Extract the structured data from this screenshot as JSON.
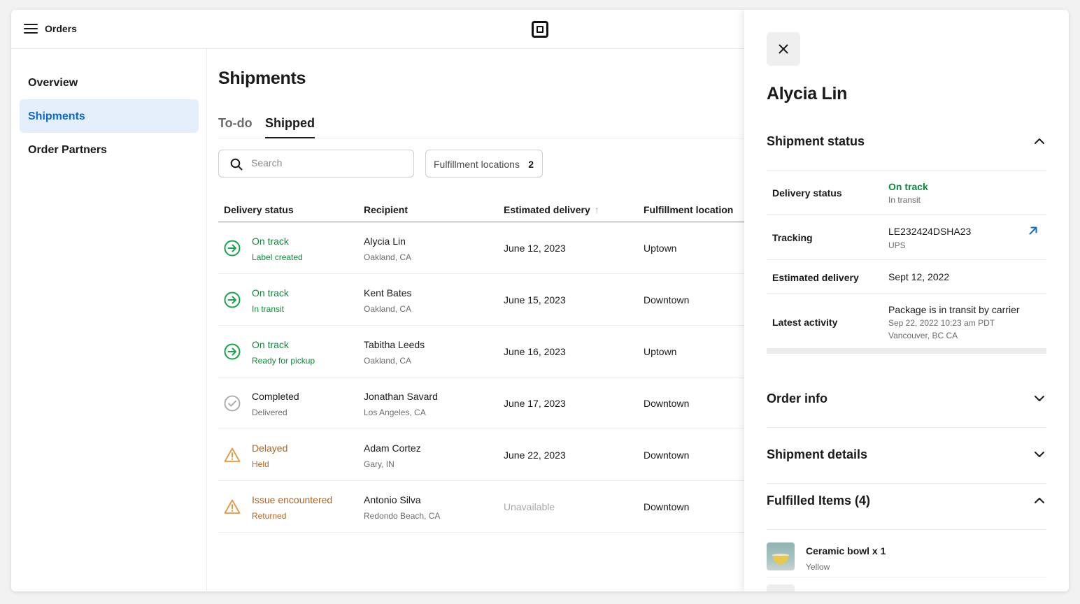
{
  "app": {
    "title": "Orders"
  },
  "sidebar": {
    "items": [
      {
        "label": "Overview",
        "active": false
      },
      {
        "label": "Shipments",
        "active": true
      },
      {
        "label": "Order Partners",
        "active": false
      }
    ]
  },
  "main": {
    "title": "Shipments",
    "tabs": [
      {
        "label": "To-do",
        "active": false
      },
      {
        "label": "Shipped",
        "active": true
      }
    ],
    "search": {
      "placeholder": "Search",
      "value": ""
    },
    "filter": {
      "label": "Fulfillment locations",
      "count": "2"
    },
    "table": {
      "headers": {
        "status": "Delivery status",
        "recipient": "Recipient",
        "delivery": "Estimated delivery",
        "location": "Fulfillment location"
      },
      "sort": {
        "column": "Estimated delivery",
        "direction": "ascending"
      },
      "rows": [
        {
          "status": "On track",
          "sub": "Label created",
          "status_kind": "on-track",
          "recipient": "Alycia Lin",
          "city": "Oakland, CA",
          "date": "June 12, 2023",
          "location": "Uptown"
        },
        {
          "status": "On track",
          "sub": "In transit",
          "status_kind": "on-track",
          "recipient": "Kent Bates",
          "city": "Oakland, CA",
          "date": "June 15, 2023",
          "location": "Downtown"
        },
        {
          "status": "On track",
          "sub": "Ready for pickup",
          "status_kind": "on-track",
          "recipient": "Tabitha Leeds",
          "city": "Oakland, CA",
          "date": "June 16, 2023",
          "location": "Uptown"
        },
        {
          "status": "Completed",
          "sub": "Delivered",
          "status_kind": "completed",
          "recipient": "Jonathan Savard",
          "city": "Los Angeles, CA",
          "date": "June 17, 2023",
          "location": "Downtown"
        },
        {
          "status": "Delayed",
          "sub": "Held",
          "status_kind": "warning",
          "recipient": "Adam Cortez",
          "city": "Gary, IN",
          "date": "June 22, 2023",
          "location": "Downtown"
        },
        {
          "status": "Issue encountered",
          "sub": "Returned",
          "status_kind": "warning",
          "recipient": "Antonio Silva",
          "city": "Redondo Beach, CA",
          "date": "Unavailable",
          "location": "Downtown"
        }
      ]
    }
  },
  "panel": {
    "title": "Alycia Lin",
    "shipment_status": {
      "title": "Shipment status",
      "expanded": true,
      "delivery_status": {
        "label": "Delivery status",
        "value": "On track",
        "sub": "In transit"
      },
      "tracking": {
        "label": "Tracking",
        "value": "LE232424DSHA23",
        "sub": "UPS"
      },
      "estimated_delivery": {
        "label": "Estimated delivery",
        "value": "Sept 12, 2022"
      },
      "latest_activity": {
        "label": "Latest activity",
        "value": "Package is in transit by carrier",
        "time": "Sep 22, 2022 10:23 am PDT",
        "place": "Vancouver, BC CA"
      }
    },
    "order_info": {
      "title": "Order info",
      "expanded": false
    },
    "shipment_details": {
      "title": "Shipment details",
      "expanded": false
    },
    "fulfilled_items": {
      "title": "Fulfilled Items (4)",
      "expanded": true,
      "items": [
        {
          "name": "Ceramic bowl x 1",
          "variant": "Yellow"
        }
      ]
    }
  },
  "icons": {
    "menu": "menu-icon",
    "logo": "square-logo-icon",
    "search": "search-icon",
    "on_track": "arrow-circle-right-icon",
    "completed": "check-circle-icon",
    "warning": "warning-triangle-icon",
    "close": "close-icon",
    "external": "external-link-icon",
    "chevron_up": "chevron-up-icon",
    "chevron_down": "chevron-down-icon"
  },
  "colors": {
    "accent": "#0b6bd4",
    "accent_bg": "#e5effb",
    "success": "#0c8a3a",
    "success_icon": "#1aa34a",
    "warning": "#b5641a",
    "warning_icon": "#e8973a",
    "neutral_icon": "#a8a8a8"
  }
}
